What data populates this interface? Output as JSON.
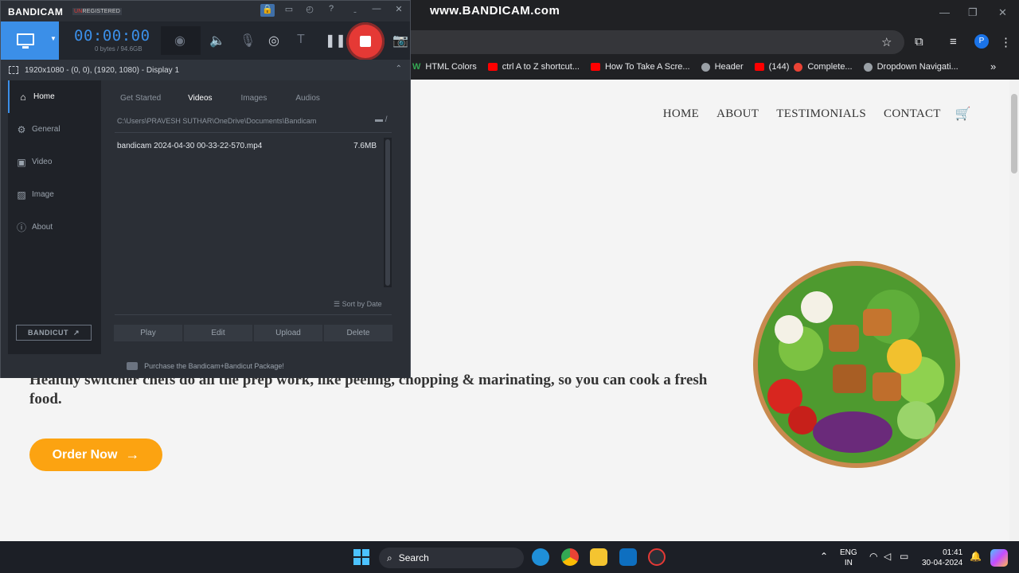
{
  "browser": {
    "watermark": "www.BANDICAM.com",
    "bookmarks": [
      {
        "label": "HTML Colors",
        "icon": "green-w-icon"
      },
      {
        "label": "ctrl A to Z shortcut...",
        "icon": "youtube-icon"
      },
      {
        "label": "How To Take A Scre...",
        "icon": "youtube-icon"
      },
      {
        "label": "Header",
        "icon": "globe-icon"
      },
      {
        "label": "(144)",
        "icon": "youtube-icon"
      },
      {
        "label": "Complete...",
        "icon": "red-circle-icon"
      },
      {
        "label": "Dropdown Navigati...",
        "icon": "globe-icon"
      }
    ],
    "profile_initial": "P"
  },
  "website": {
    "nav": [
      "HOME",
      "ABOUT",
      "TESTIMONIALS",
      "CONTACT"
    ],
    "hero_text": "Healthy switcher chefs do all the prep work, like peeling, chopping & marinating, so you can cook a fresh food.",
    "order_button": "Order Now"
  },
  "bandicam": {
    "logo": "BANDICAM",
    "unregistered_prefix": "UN",
    "unregistered_rest": "REGISTERED",
    "timer": "00:00:00",
    "bytes": "0 bytes / 94.6GB",
    "resolution": "1920x1080 - (0, 0), (1920, 1080) - Display 1",
    "sidebar": [
      "Home",
      "General",
      "Video",
      "Image",
      "About"
    ],
    "bandicut_label": "BANDICUT",
    "tabs": [
      "Get Started",
      "Videos",
      "Images",
      "Audios"
    ],
    "path": "C:\\Users\\PRAVESH SUTHAR\\OneDrive\\Documents\\Bandicam",
    "files": [
      {
        "name": "bandicam 2024-04-30 00-33-22-570.mp4",
        "size": "7.6MB"
      }
    ],
    "sort_label": "Sort by Date",
    "actions": [
      "Play",
      "Edit",
      "Upload",
      "Delete"
    ],
    "purchase_text": "Purchase the Bandicam+Bandicut Package!"
  },
  "taskbar": {
    "search_label": "Search",
    "lang_top": "ENG",
    "lang_bottom": "IN",
    "time": "01:41",
    "date": "30-04-2024"
  },
  "colors": {
    "accent_blue": "#3b8fe8",
    "record_red": "#e53935",
    "order_orange": "#fca311"
  }
}
